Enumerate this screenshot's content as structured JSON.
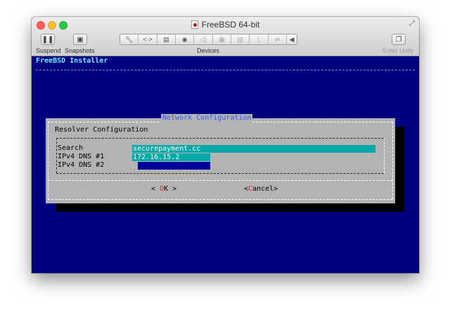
{
  "window": {
    "title": "FreeBSD 64-bit"
  },
  "toolbar": {
    "suspend_label": "Suspend",
    "snapshots_label": "Snapshots",
    "devices_label": "Devices",
    "enter_unity_label": "Enter Unity",
    "device_icons": [
      "wrench-icon",
      "network-arrows-icon",
      "disk-icon",
      "camera-icon",
      "speaker-icon",
      "cd-icon",
      "printer-icon",
      "bluetooth-icon",
      "usb-icon"
    ]
  },
  "installer": {
    "title": "FreeBSD Installer"
  },
  "dialog": {
    "title": "Network Configuration",
    "form_title": "Resolver Configuration",
    "fields": [
      {
        "label": "Search",
        "value": "securepayment.cc"
      },
      {
        "label": "IPv4 DNS #1",
        "value": "172.16.15.2"
      },
      {
        "label": "IPv4 DNS #2",
        "value": ""
      }
    ],
    "ok_button": {
      "pre": "< ",
      "hot": "O",
      "rest": "K",
      "post": " >"
    },
    "cancel_button": {
      "pre": "<",
      "hot": "C",
      "rest": "ancel",
      "post": ">"
    }
  },
  "colors": {
    "terminal_bg": "#000080",
    "dialog_bg": "#b3b3b3",
    "active_field": "#00a8a8",
    "field_blue": "#000099",
    "dialog_title": "#3355ee",
    "hotkey": "#cc2222"
  }
}
